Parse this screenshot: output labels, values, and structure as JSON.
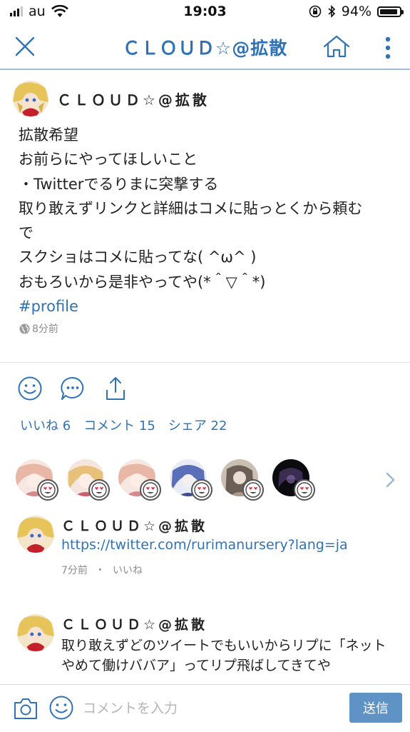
{
  "status_bar": {
    "carrier": "au",
    "time": "19:03",
    "battery": "94%",
    "battery_level": 0.94
  },
  "nav": {
    "title": "ＣＬＯＵＤ☆@拡散"
  },
  "post": {
    "author": "ＣＬＯＵＤ☆@拡散",
    "lines": [
      "拡散希望",
      "お前らにやってほしいこと",
      "・Twitterでるりまに突撃する",
      "取り敢えずリンクと詳細はコメに貼っとくから頼む",
      "で",
      "スクショはコメに貼ってな( ^ω^ )",
      "おもろいから是非やってや(*＾▽＾*)"
    ],
    "hashtag": "#profile",
    "time": "8分前"
  },
  "stats": {
    "likes": "いいね 6",
    "comments": "コメント 15",
    "shares": "シェア 22"
  },
  "comments": [
    {
      "author": "ＣＬＯＵＤ☆@拡散",
      "link": "https://twitter.com/rurimanursery?lang=ja",
      "time": "7分前",
      "separator": "・",
      "like": "いいね"
    },
    {
      "author": "ＣＬＯＵＤ☆@拡散",
      "text": "取り敢えずどのツイートでもいいからリプに「ネットやめて働けババア」ってリプ飛ばしてきてや"
    }
  ],
  "input": {
    "placeholder": "コメントを入力",
    "send_label": "送信"
  },
  "colors": {
    "accent": "#2f73b6",
    "send_button": "#5f93c6",
    "meta_gray": "#8c8c8c"
  },
  "icons": [
    "close-icon",
    "home-icon",
    "more-vertical-icon",
    "globe-icon",
    "smile-icon",
    "comment-icon",
    "share-icon",
    "heart-eyes-icon",
    "chevron-right-icon",
    "camera-icon",
    "emoji-icon"
  ]
}
